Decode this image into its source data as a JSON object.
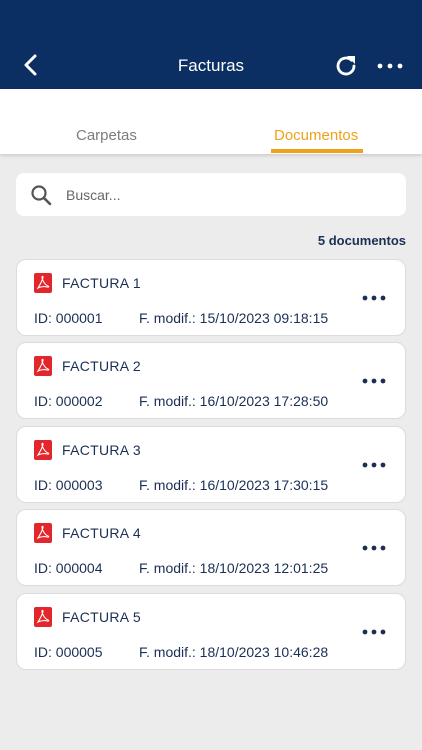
{
  "header": {
    "title": "Facturas",
    "back_icon": "chevron-left-icon",
    "refresh_icon": "refresh-icon",
    "more_icon": "more-horizontal-icon",
    "bg_color": "#0b2f63"
  },
  "tabs": [
    {
      "label": "Carpetas",
      "active": false
    },
    {
      "label": "Documentos",
      "active": true
    }
  ],
  "accent_color": "#f0a11a",
  "search": {
    "placeholder": "Buscar...",
    "value": ""
  },
  "count_label": "5 documentos",
  "documents": [
    {
      "name": "FACTURA 1",
      "id": "ID: 000001",
      "modified": "F. modif.: 15/10/2023 09:18:15"
    },
    {
      "name": "FACTURA 2",
      "id": "ID: 000002",
      "modified": "F. modif.: 16/10/2023 17:28:50"
    },
    {
      "name": "FACTURA 3",
      "id": "ID: 000003",
      "modified": "F. modif.: 16/10/2023 17:30:15"
    },
    {
      "name": "FACTURA 4",
      "id": "ID: 000004",
      "modified": "F. modif.: 18/10/2023 12:01:25"
    },
    {
      "name": "FACTURA 5",
      "id": "ID: 000005",
      "modified": "F. modif.: 18/10/2023 10:46:28"
    }
  ]
}
